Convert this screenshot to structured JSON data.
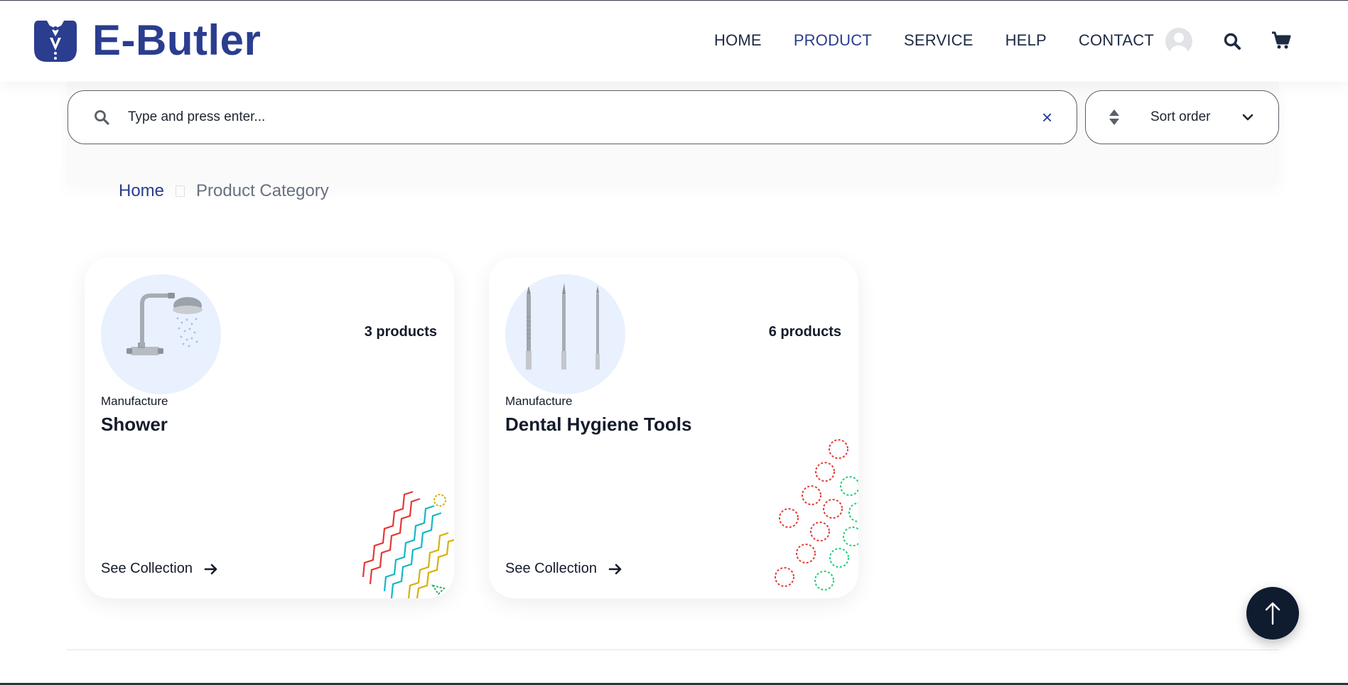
{
  "brand": {
    "name": "E-Butler",
    "color": "#2a3d8f",
    "logo_icon": "butler-tuxedo-icon"
  },
  "nav": {
    "items": [
      {
        "label": "HOME",
        "active": false
      },
      {
        "label": "PRODUCT",
        "active": true
      },
      {
        "label": "SERVICE",
        "active": false
      },
      {
        "label": "HELP",
        "active": false
      },
      {
        "label": "CONTACT",
        "active": false
      }
    ],
    "icons": [
      "user-avatar-icon",
      "search-icon",
      "cart-icon"
    ]
  },
  "search": {
    "placeholder": "Type and press enter...",
    "value": "",
    "clear_label": "×"
  },
  "sort": {
    "label": "Sort order"
  },
  "breadcrumb": {
    "home": "Home",
    "current": "Product Category"
  },
  "cards": [
    {
      "count": "3 products",
      "subtitle": "Manufacture",
      "title": "Shower",
      "link": "See Collection",
      "image": "shower-head-image",
      "decoration": "zigzag-lines"
    },
    {
      "count": "6 products",
      "subtitle": "Manufacture",
      "title": "Dental Hygiene Tools",
      "link": "See Collection",
      "image": "dental-tools-image",
      "decoration": "dotted-circles"
    }
  ],
  "scroll_top": {
    "icon": "arrow-up-icon"
  },
  "colors": {
    "accent": "#2a3d8f",
    "text": "#1d2a44",
    "card_image_bg": "#e8f1fd",
    "scroll_button": "#0f1b2f"
  }
}
